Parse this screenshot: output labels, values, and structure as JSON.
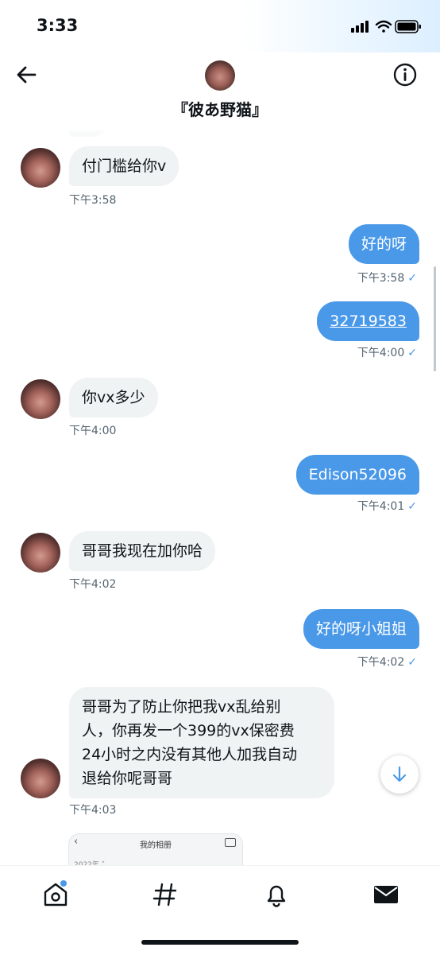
{
  "status": {
    "time": "3:33"
  },
  "header": {
    "title": "『彼あ野猫』"
  },
  "messages": [
    {
      "dir": "in",
      "text": "付门槛给你v",
      "time": "下午3:58"
    },
    {
      "dir": "out",
      "text": "好的呀",
      "time": "下午3:58"
    },
    {
      "dir": "out",
      "text": "32719583",
      "time": "下午4:00",
      "link": true
    },
    {
      "dir": "in",
      "text": "你vx多少",
      "time": "下午4:00"
    },
    {
      "dir": "out",
      "text": "Edison52096",
      "time": "下午4:01"
    },
    {
      "dir": "in",
      "text": "哥哥我现在加你哈",
      "time": "下午4:02"
    },
    {
      "dir": "out",
      "text": "好的呀小姐姐",
      "time": "下午4:02"
    },
    {
      "dir": "in",
      "lines": [
        "哥哥为了防止你把我vx乱给别",
        "人，你再发一个399的vx保密费",
        "24小时之内没有其他人加我自动",
        "退给你呢哥哥"
      ],
      "time": "下午4:03"
    }
  ],
  "image_preview": {
    "title": "我的相册",
    "year": "2022年 ˅",
    "back": "‹"
  },
  "tick": "✓",
  "icons": {
    "back": "arrow-left-icon",
    "info": "info-icon",
    "scroll": "arrow-down-icon",
    "tabs": [
      "home-icon",
      "hashtag-icon",
      "bell-icon",
      "mail-icon"
    ]
  },
  "colors": {
    "accent": "#4a99e9",
    "bubble_in": "#eff3f4",
    "text": "#0f1419",
    "muted": "#536471"
  }
}
